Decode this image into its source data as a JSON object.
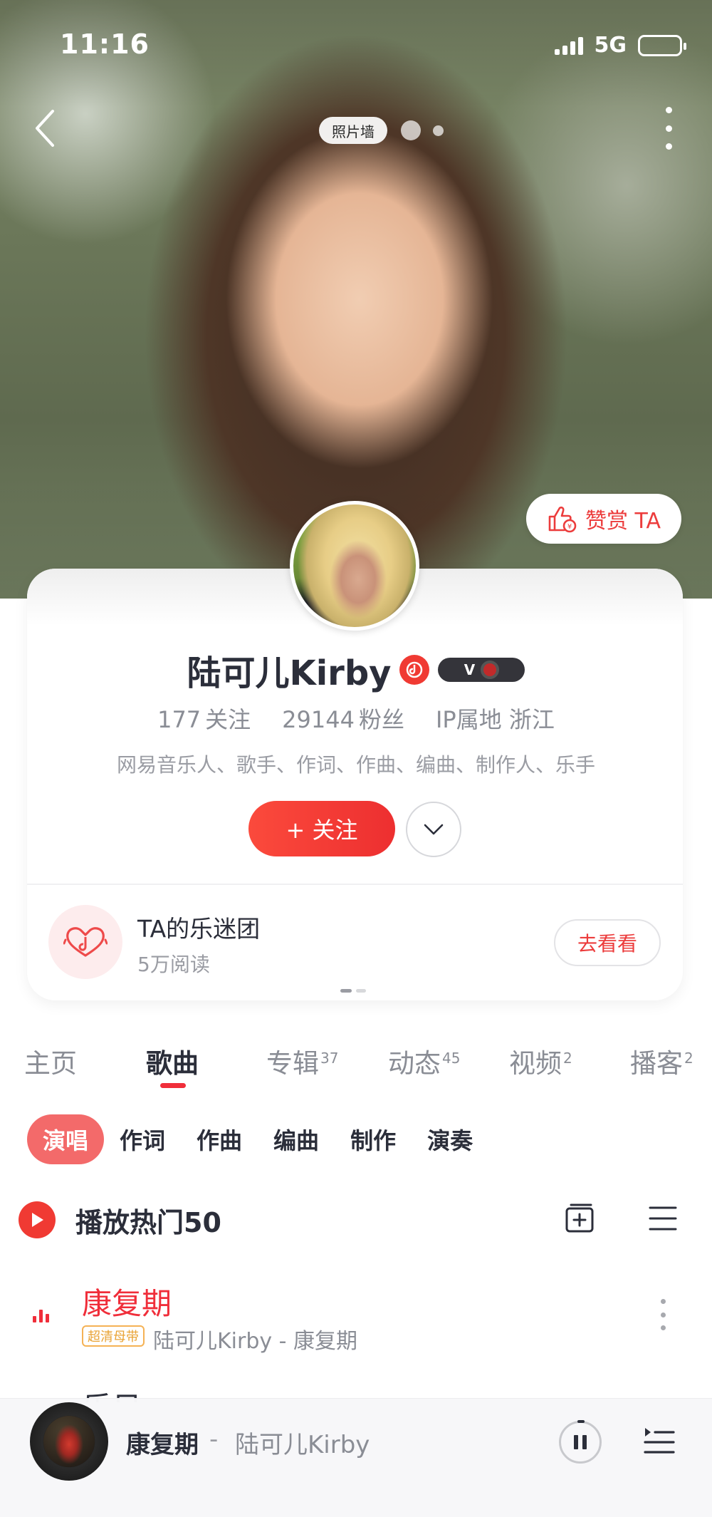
{
  "status_bar": {
    "time": "11:16",
    "network": "5G"
  },
  "hero": {
    "photo_wall_label": "照片墙",
    "reward_label": "赞赏 TA"
  },
  "profile": {
    "name": "陆可儿Kirby",
    "level_badge": "V",
    "following_count": "177",
    "following_label": "关注",
    "followers_count": "29144",
    "followers_label": "粉丝",
    "ip_location": "IP属地 浙江",
    "bio": "网易音乐人、歌手、作词、作曲、编曲、制作人、乐手",
    "follow_button": "+ 关注"
  },
  "fan_group": {
    "title": "TA的乐迷团",
    "subtitle": "5万阅读",
    "action": "去看看"
  },
  "tabs": [
    {
      "label": "主页",
      "count": ""
    },
    {
      "label": "歌曲",
      "count": ""
    },
    {
      "label": "专辑",
      "count": "37"
    },
    {
      "label": "动态",
      "count": "45"
    },
    {
      "label": "视频",
      "count": "2"
    },
    {
      "label": "播客",
      "count": "2"
    }
  ],
  "active_tab": "歌曲",
  "chips": [
    "演唱",
    "作词",
    "作曲",
    "编曲",
    "制作",
    "演奏"
  ],
  "active_chip": "演唱",
  "play_hot": {
    "label": "播放热门50"
  },
  "songs": [
    {
      "title": "康复期",
      "badge": "超清母带",
      "meta": "陆可儿Kirby - 康复期",
      "playing": true
    },
    {
      "title": "乐日",
      "badge": "",
      "meta": "",
      "playing": false
    }
  ],
  "player": {
    "title": "康复期",
    "separator": "-",
    "artist": "陆可儿Kirby",
    "state": "playing"
  },
  "colors": {
    "accent": "#f02e3a",
    "follow_button": "#f5403a",
    "chip_active": "#f36a6a",
    "badge_gold": "#e9a335"
  },
  "icons": {
    "back": "chevron-left-icon",
    "more": "vertical-dots-icon",
    "reward": "thumbs-up-coin-icon",
    "verify": "music-note-badge-icon",
    "expand": "chevron-down-icon",
    "fan_group": "heart-music-icon",
    "play": "play-icon",
    "add": "add-to-playlist-icon",
    "list": "list-menu-icon",
    "pause": "pause-icon",
    "playlist": "playlist-queue-icon"
  }
}
